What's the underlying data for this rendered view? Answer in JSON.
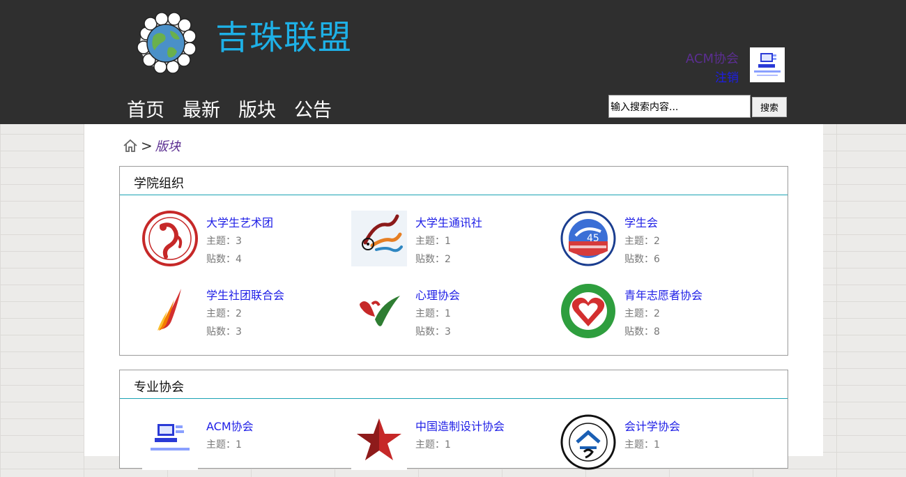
{
  "header": {
    "site_title": "吉珠联盟",
    "user_name": "ACM协会",
    "logout_label": "注销",
    "nav": [
      "首页",
      "最新",
      "版块",
      "公告"
    ],
    "search_placeholder": "输入搜索内容...",
    "search_button": "搜索"
  },
  "breadcrumb": {
    "sep": ">",
    "current": "版块"
  },
  "labels": {
    "topics": "主题：",
    "posts": "贴数："
  },
  "sections": [
    {
      "title": "学院组织",
      "items": [
        {
          "name": "大学生艺术团",
          "topics": "3",
          "posts": "4",
          "logo": "art-troupe-logo"
        },
        {
          "name": "大学生通讯社",
          "topics": "1",
          "posts": "2",
          "logo": "news-agency-logo"
        },
        {
          "name": "学生会",
          "topics": "2",
          "posts": "6",
          "logo": "student-union-logo"
        },
        {
          "name": "学生社团联合会",
          "topics": "2",
          "posts": "3",
          "logo": "club-federation-logo"
        },
        {
          "name": "心理协会",
          "topics": "1",
          "posts": "3",
          "logo": "psychology-logo"
        },
        {
          "name": "青年志愿者协会",
          "topics": "2",
          "posts": "8",
          "logo": "volunteer-logo"
        }
      ]
    },
    {
      "title": "专业协会",
      "items": [
        {
          "name": "ACM协会",
          "topics": "1",
          "logo": "acm-logo"
        },
        {
          "name": "中国造制设计协会",
          "topics": "1",
          "logo": "design-logo"
        },
        {
          "name": "会计学协会",
          "topics": "1",
          "logo": "accounting-logo"
        }
      ]
    }
  ],
  "colors": {
    "header_bg": "#2f2f2f",
    "title_blue": "#1eb0e6",
    "link_blue": "#1d1de6",
    "visited_purple": "#5b2e91",
    "section_rule": "#1aa3b4"
  }
}
